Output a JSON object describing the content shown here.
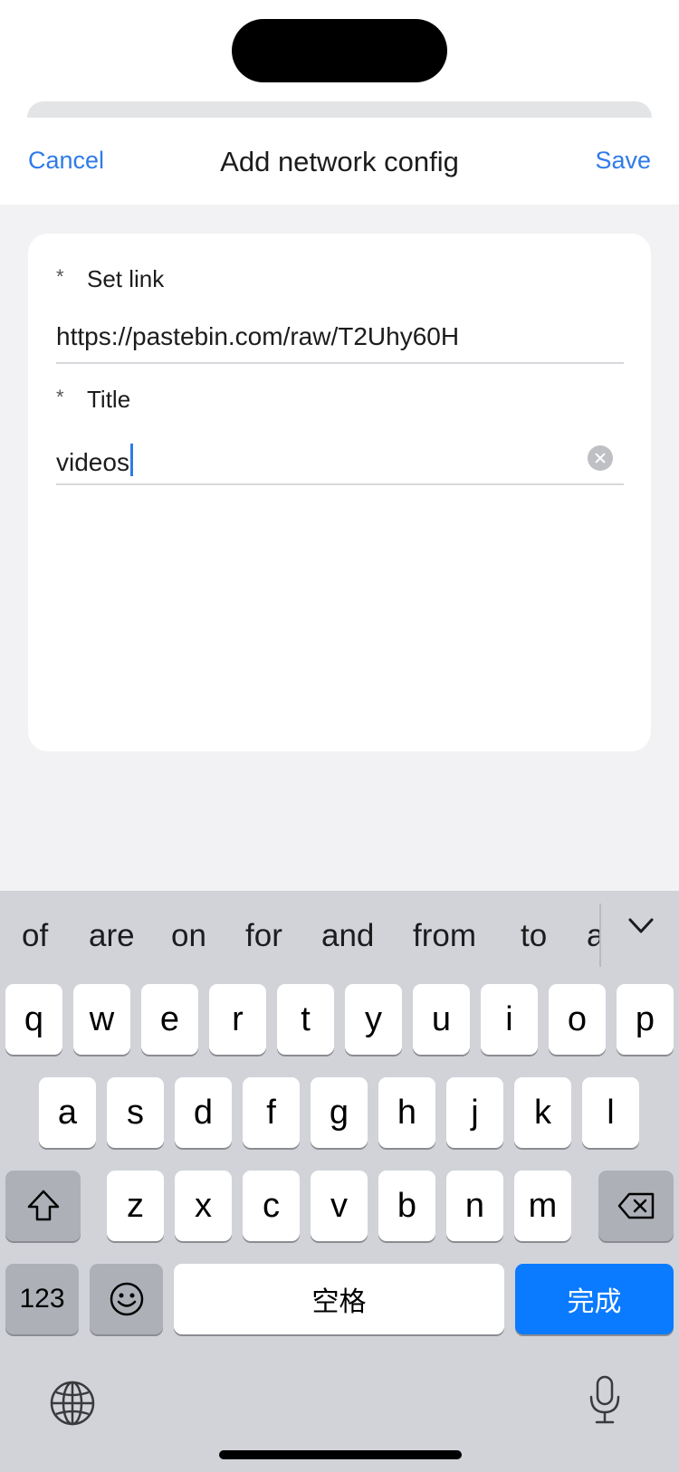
{
  "nav": {
    "cancel": "Cancel",
    "title": "Add network config",
    "save": "Save"
  },
  "form": {
    "link": {
      "required_mark": "*",
      "label": "Set link",
      "value": "https://pastebin.com/raw/T2Uhy60H"
    },
    "title": {
      "required_mark": "*",
      "label": "Title",
      "value": "videos"
    }
  },
  "keyboard": {
    "suggestions": [
      "of",
      "are",
      "on",
      "for",
      "and",
      "from",
      "to",
      "a"
    ],
    "row1": [
      "q",
      "w",
      "e",
      "r",
      "t",
      "y",
      "u",
      "i",
      "o",
      "p"
    ],
    "row2": [
      "a",
      "s",
      "d",
      "f",
      "g",
      "h",
      "j",
      "k",
      "l"
    ],
    "row3": [
      "z",
      "x",
      "c",
      "v",
      "b",
      "n",
      "m"
    ],
    "numbers_key": "123",
    "space_key": "空格",
    "done_key": "完成",
    "icons": {
      "shift": "shift-arrow-icon",
      "backspace": "backspace-icon",
      "emoji": "emoji-face-icon",
      "globe": "globe-icon",
      "mic": "microphone-icon",
      "collapse": "chevron-down-icon"
    },
    "colors": {
      "done_key": "#0a7aff",
      "accent": "#2f7be8"
    }
  }
}
